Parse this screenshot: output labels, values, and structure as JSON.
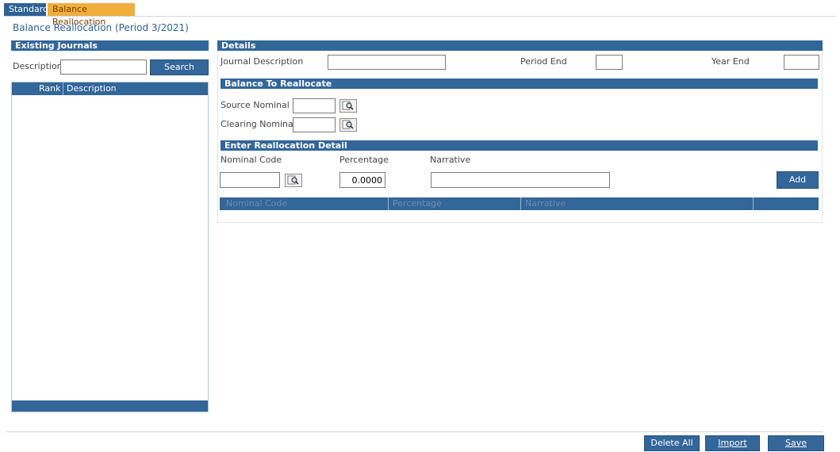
{
  "tabs": [
    {
      "label": "Standard",
      "active": false
    },
    {
      "label": "Balance Reallocation",
      "active": true
    }
  ],
  "page_title": "Balance Reallocation (Period 3/2021)",
  "existing_journals": {
    "title": "Existing Journals",
    "description_label": "Description",
    "description_value": "",
    "search_button": "Search",
    "columns": [
      "Rank",
      "Description"
    ],
    "rows": []
  },
  "details": {
    "title": "Details",
    "journal_description_label": "Journal Description",
    "journal_description_value": "",
    "period_end_label": "Period End",
    "period_end_value": "",
    "year_end_label": "Year End",
    "year_end_value": ""
  },
  "balance_to_reallocate": {
    "title": "Balance To Reallocate",
    "source_nominal_label": "Source Nominal",
    "source_nominal_value": "",
    "clearing_nominal_label": "Clearing Nominal",
    "clearing_nominal_value": ""
  },
  "reallocation_detail": {
    "title": "Enter Reallocation Detail",
    "nominal_code_label": "Nominal Code",
    "nominal_code_value": "",
    "percentage_label": "Percentage",
    "percentage_value": "0.0000",
    "narrative_label": "Narrative",
    "narrative_value": "",
    "add_button": "Add",
    "grid_columns": [
      "Nominal Code",
      "Percentage",
      "Narrative"
    ],
    "grid_rows": []
  },
  "footer": {
    "delete_all_button": "Delete All",
    "import_button": "Import",
    "save_button": "Save"
  },
  "colors": {
    "header_blue": "#336699",
    "tab_active": "#f0ae3c",
    "title_blue": "#2f6294"
  }
}
